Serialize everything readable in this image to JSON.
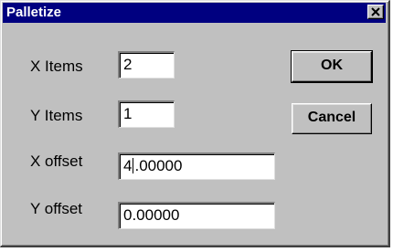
{
  "window": {
    "title": "Palletize",
    "close_icon": "close-icon"
  },
  "form": {
    "x_items": {
      "label": "X Items",
      "value": "2"
    },
    "y_items": {
      "label": "Y Items",
      "value": "1"
    },
    "x_offset": {
      "label": "X offset",
      "value_before_caret": "4",
      "value_after_caret": ".00000"
    },
    "y_offset": {
      "label": "Y offset",
      "value": "0.00000"
    }
  },
  "buttons": {
    "ok_label": "OK",
    "cancel_label": "Cancel"
  },
  "colors": {
    "title_bar": "#000080",
    "face": "#c0c0c0",
    "field_bg": "#ffffff"
  }
}
